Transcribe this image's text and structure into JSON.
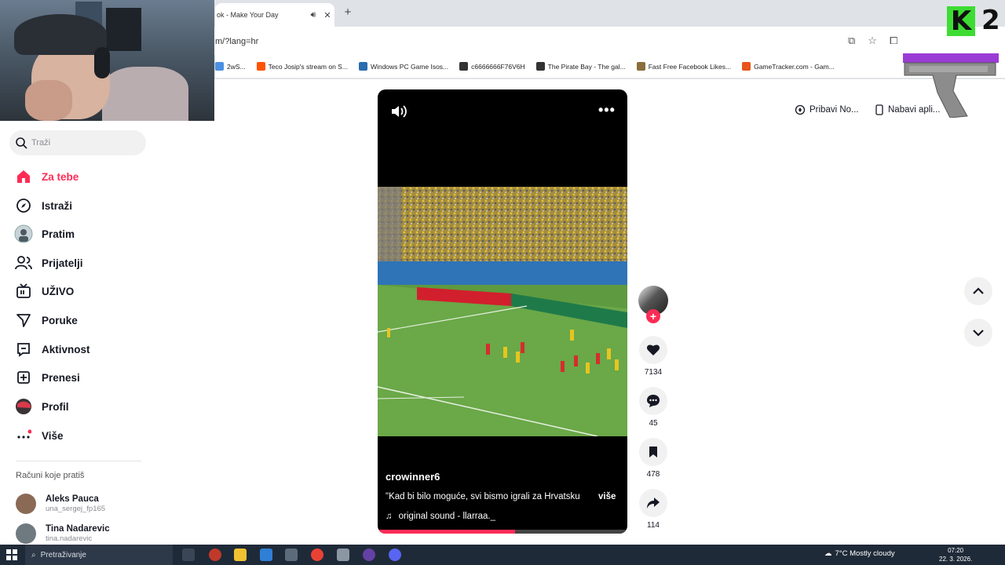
{
  "browser": {
    "tab_title": "ok - Make Your Day",
    "url": "m/?lang=hr",
    "bookmarks": [
      {
        "label": "2wS...",
        "color": "#4a90e2"
      },
      {
        "label": "Teco Josip's stream on S...",
        "color": "#ff5500"
      },
      {
        "label": "Windows PC Game Isos...",
        "color": "#2b6cb0"
      },
      {
        "label": "c6666666F76V6H",
        "color": "#333333"
      },
      {
        "label": "The Pirate Bay - The gal...",
        "color": "#333333"
      },
      {
        "label": "Fast Free Facebook Likes...",
        "color": "#555555"
      },
      {
        "label": "GameTracker.com - Gam...",
        "color": "#e8541b"
      }
    ]
  },
  "overlay": {
    "logo_letter": "K",
    "logo_number": "2"
  },
  "sidebar": {
    "search_placeholder": "Traži",
    "items": [
      {
        "label": "Za tebe",
        "icon": "home-icon"
      },
      {
        "label": "Istraži",
        "icon": "compass-icon"
      },
      {
        "label": "Pratim",
        "icon": "avatar-icon"
      },
      {
        "label": "Prijatelji",
        "icon": "friends-icon"
      },
      {
        "label": "UŽIVO",
        "icon": "live-icon"
      },
      {
        "label": "Poruke",
        "icon": "send-icon"
      },
      {
        "label": "Aktivnost",
        "icon": "activity-icon"
      },
      {
        "label": "Prenesi",
        "icon": "upload-icon"
      },
      {
        "label": "Profil",
        "icon": "profile-avatar-icon"
      },
      {
        "label": "Više",
        "icon": "more-dots-icon"
      }
    ],
    "following_title": "Računi koje pratiš",
    "accounts": [
      {
        "name": "Aleks Pauca",
        "username": "una_sergej_fp165"
      },
      {
        "name": "Tina Nadarevic",
        "username": "tina.nadarevic"
      }
    ]
  },
  "top_actions": {
    "get_coins": "Pribavi No...",
    "get_app": "Nabavi apli..."
  },
  "video": {
    "author": "crowinner6",
    "caption": "\"Kad bi bilo moguće, svi bismo igrali za Hrvatsku",
    "more_label": "više",
    "sound": "original sound - llarraa._",
    "progress": 0.55
  },
  "actions": {
    "likes": "7134",
    "comments": "45",
    "saves": "478",
    "shares": "114"
  },
  "taskbar": {
    "search_label": "Pretraživanje",
    "weather": "7°C  Mostly cloudy",
    "time": "07:20",
    "date": "22. 3. 2026."
  },
  "colors": {
    "accent": "#fe2c55",
    "text": "#161823",
    "muted": "#8a8b91"
  }
}
